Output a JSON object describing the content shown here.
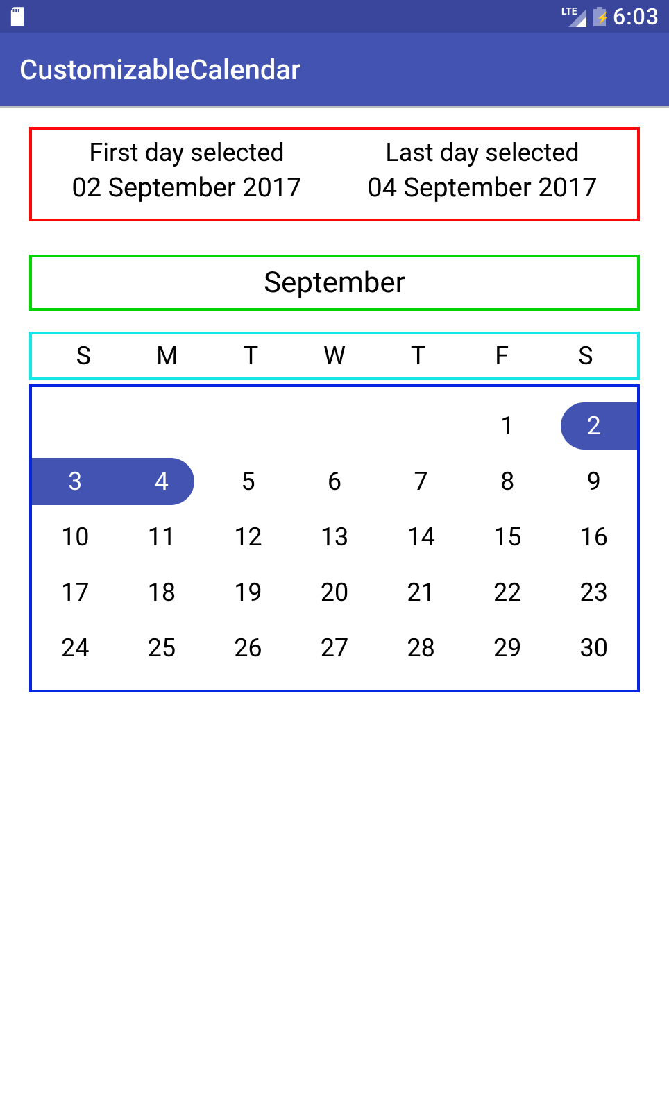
{
  "status": {
    "time": "6:03",
    "lte": "LTE"
  },
  "appbar": {
    "title": "CustomizableCalendar"
  },
  "selection": {
    "first_label": "First day selected",
    "first_date": "02 September 2017",
    "last_label": "Last day selected",
    "last_date": "04 September 2017"
  },
  "month": {
    "name": "September"
  },
  "weekdays": [
    "S",
    "M",
    "T",
    "W",
    "T",
    "F",
    "S"
  ],
  "calendar": {
    "weeks": [
      [
        "",
        "",
        "",
        "",
        "",
        "1",
        "2"
      ],
      [
        "3",
        "4",
        "5",
        "6",
        "7",
        "8",
        "9"
      ],
      [
        "10",
        "11",
        "12",
        "13",
        "14",
        "15",
        "16"
      ],
      [
        "17",
        "18",
        "19",
        "20",
        "21",
        "22",
        "23"
      ],
      [
        "24",
        "25",
        "26",
        "27",
        "28",
        "29",
        "30"
      ]
    ],
    "selected": [
      "2",
      "3",
      "4"
    ],
    "range_start": "2",
    "range_end": "4"
  },
  "colors": {
    "primary": "#4253b2",
    "primary_dark": "#39469c",
    "border_red": "#ff0808",
    "border_green": "#04d404",
    "border_cyan": "#16e6e6",
    "border_blue": "#0525e2"
  }
}
